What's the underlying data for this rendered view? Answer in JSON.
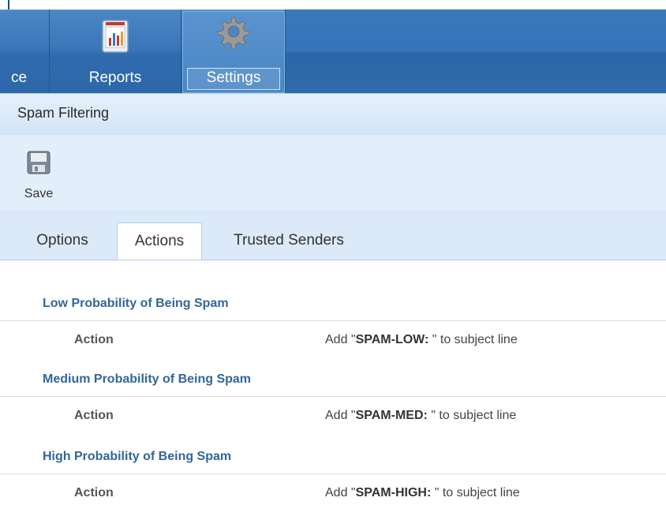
{
  "nav": {
    "partial_label": "ce",
    "reports_label": "Reports",
    "settings_label": "Settings"
  },
  "section": {
    "title": "Spam Filtering"
  },
  "toolbar": {
    "save_label": "Save"
  },
  "tabs": [
    {
      "label": "Options",
      "active": false
    },
    {
      "label": "Actions",
      "active": true
    },
    {
      "label": "Trusted Senders",
      "active": false
    }
  ],
  "groups": [
    {
      "title": "Low Probability of Being Spam",
      "row_label": "Action",
      "value_prefix": "Add \"",
      "value_tag": "SPAM-LOW: ",
      "value_suffix": "\" to subject line"
    },
    {
      "title": "Medium Probability of Being Spam",
      "row_label": "Action",
      "value_prefix": "Add \"",
      "value_tag": "SPAM-MED: ",
      "value_suffix": "\" to subject line"
    },
    {
      "title": "High Probability of Being Spam",
      "row_label": "Action",
      "value_prefix": "Add \"",
      "value_tag": "SPAM-HIGH: ",
      "value_suffix": "\" to subject line"
    }
  ],
  "colors": {
    "nav_blue": "#3a77b9",
    "group_title": "#336699",
    "header_bg": "#d3e4f7"
  },
  "icons": [
    "reports-icon",
    "gear-icon",
    "save-icon"
  ]
}
